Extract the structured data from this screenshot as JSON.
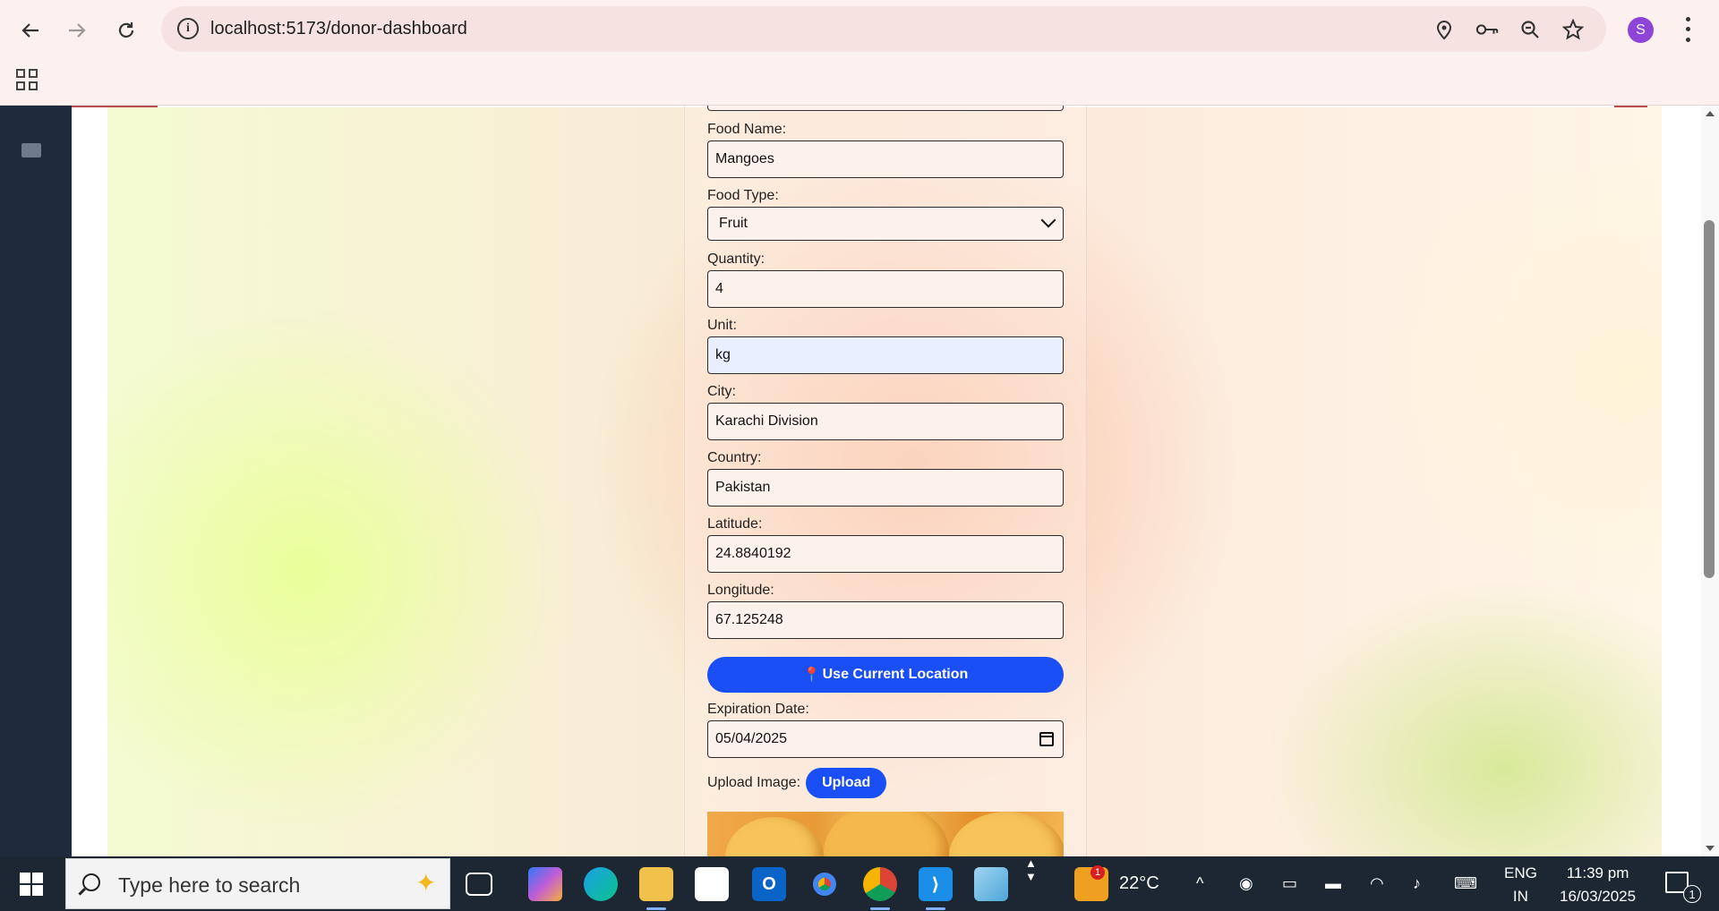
{
  "browser": {
    "url": "localhost:5173/donor-dashboard",
    "profile_initial": "S",
    "icons": [
      "back-icon",
      "forward-icon",
      "reload-icon",
      "site-info-icon",
      "location-icon",
      "password-key-icon",
      "zoom-icon",
      "bookmark-star-icon",
      "menu-kebab-icon",
      "apps-grid-icon"
    ]
  },
  "form": {
    "food_name_label": "Food Name:",
    "food_name_value": "Mangoes",
    "food_type_label": "Food Type:",
    "food_type_value": "Fruit",
    "quantity_label": "Quantity:",
    "quantity_value": "4",
    "unit_label": "Unit:",
    "unit_value": "kg",
    "city_label": "City:",
    "city_value": "Karachi Division",
    "country_label": "Country:",
    "country_value": "Pakistan",
    "latitude_label": "Latitude:",
    "latitude_value": "24.8840192",
    "longitude_label": "Longitude:",
    "longitude_value": "67.125248",
    "use_location_label": "Use Current Location",
    "pin_glyph": "📍",
    "expiration_label": "Expiration Date:",
    "expiration_value": "05/04/2025",
    "upload_label": "Upload Image:",
    "upload_button": "Upload"
  },
  "taskbar": {
    "search_placeholder": "Type here to search",
    "weather_temp": "22°C",
    "weather_badge": "1",
    "language_top": "ENG",
    "language_bottom": "IN",
    "time": "11:39 pm",
    "date": "16/03/2025",
    "notification_count": "1"
  },
  "colors": {
    "accent_button": "#1a4ff5",
    "sidebar": "#1f2a3c",
    "taskbar": "#1d2733",
    "profile": "#8e44d6"
  }
}
